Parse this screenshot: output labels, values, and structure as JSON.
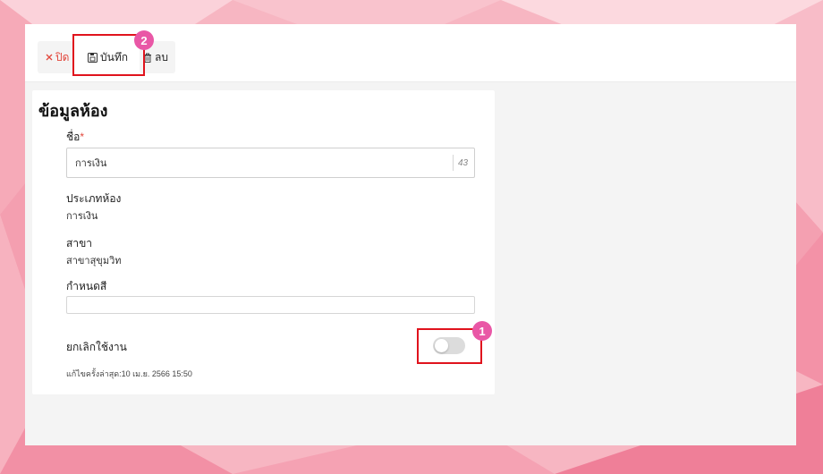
{
  "toolbar": {
    "close_label": "ปิด",
    "save_label": "บันทึก",
    "delete_label": "ลบ"
  },
  "card": {
    "title": "ข้อมูลห้อง",
    "name_label": "ชื่อ",
    "required_mark": "*",
    "name_value": "การเงิน",
    "name_counter": "43",
    "room_type_label": "ประเภทห้อง",
    "room_type_value": "การเงิน",
    "branch_label": "สาขา",
    "branch_value": "สาขาสุขุมวิท",
    "color_label": "กำหนดสี",
    "disable_label": "ยกเลิกใช้งาน",
    "disable_enabled": false,
    "last_edited": "แก้ไขครั้งล่าสุด:10 เม.ย. 2566 15:50"
  },
  "annotations": {
    "badge_1": "1",
    "badge_2": "2"
  },
  "colors": {
    "highlight": "#e0131d",
    "badge": "#e957a6",
    "close": "#e2483d",
    "background": "#f7b7c2"
  },
  "icons": {
    "close": "close-icon",
    "save": "save-icon",
    "delete": "trash-icon"
  }
}
